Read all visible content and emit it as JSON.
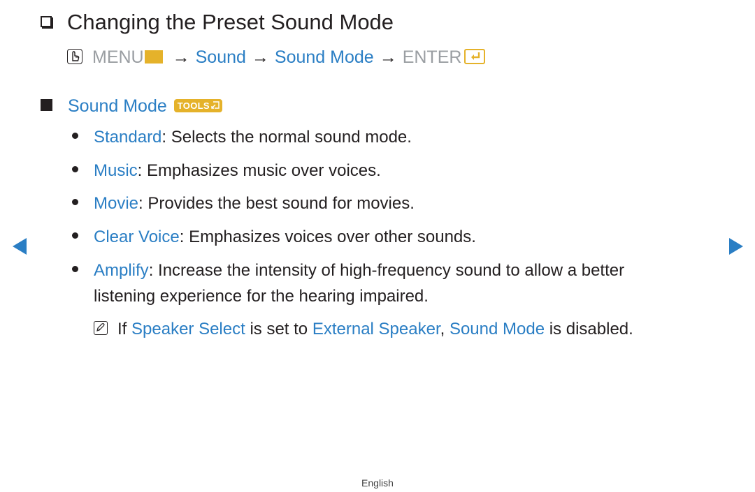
{
  "title": "Changing the Preset Sound Mode",
  "menu_path": {
    "menu_label": "MENU",
    "steps": [
      "Sound",
      "Sound Mode"
    ],
    "enter_label": "ENTER",
    "arrow": "→"
  },
  "section": {
    "label": "Sound Mode",
    "tools_badge": "TOOLS"
  },
  "options": [
    {
      "name": "Standard",
      "description": ": Selects the normal sound mode."
    },
    {
      "name": "Music",
      "description": ": Emphasizes music over voices."
    },
    {
      "name": "Movie",
      "description": ": Provides the best sound for movies."
    },
    {
      "name": "Clear Voice",
      "description": ": Emphasizes voices over other sounds."
    },
    {
      "name": "Amplify",
      "description": ": Increase the intensity of high-frequency sound to allow a better",
      "continuation": "listening experience for the hearing impaired."
    }
  ],
  "note": {
    "prefix": "If ",
    "link1": "Speaker Select",
    "mid1": " is set to ",
    "link2": "External Speaker",
    "mid2": ", ",
    "link3": "Sound Mode",
    "suffix": " is disabled."
  },
  "navigation": {
    "prev_icon": "triangle-left",
    "next_icon": "triangle-right"
  },
  "footer": {
    "language": "English"
  }
}
